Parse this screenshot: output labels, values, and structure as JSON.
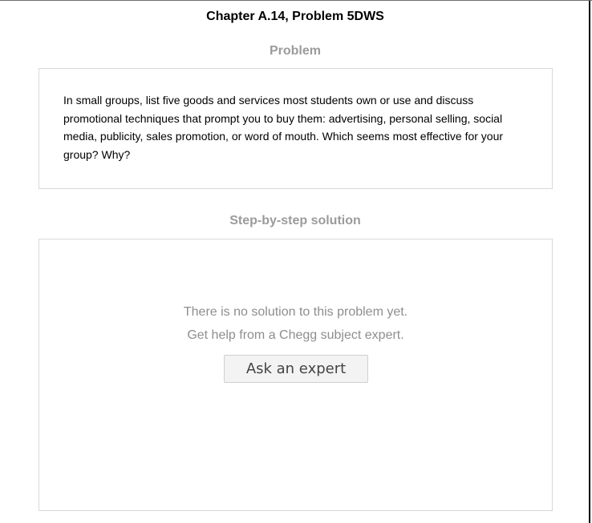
{
  "header": {
    "chapter_title": "Chapter A.14, Problem 5DWS"
  },
  "problem": {
    "heading": "Problem",
    "text": "In small groups, list five goods and services most students own or use and discuss promotional techniques that prompt you to buy them: advertising, personal selling, social media, publicity, sales promotion, or word of mouth. Which seems most effective for your group? Why?"
  },
  "solution": {
    "heading": "Step-by-step solution",
    "no_solution_line1": "There is no solution to this problem yet.",
    "no_solution_line2": "Get help from a Chegg subject expert.",
    "ask_button_label": "Ask an expert"
  }
}
